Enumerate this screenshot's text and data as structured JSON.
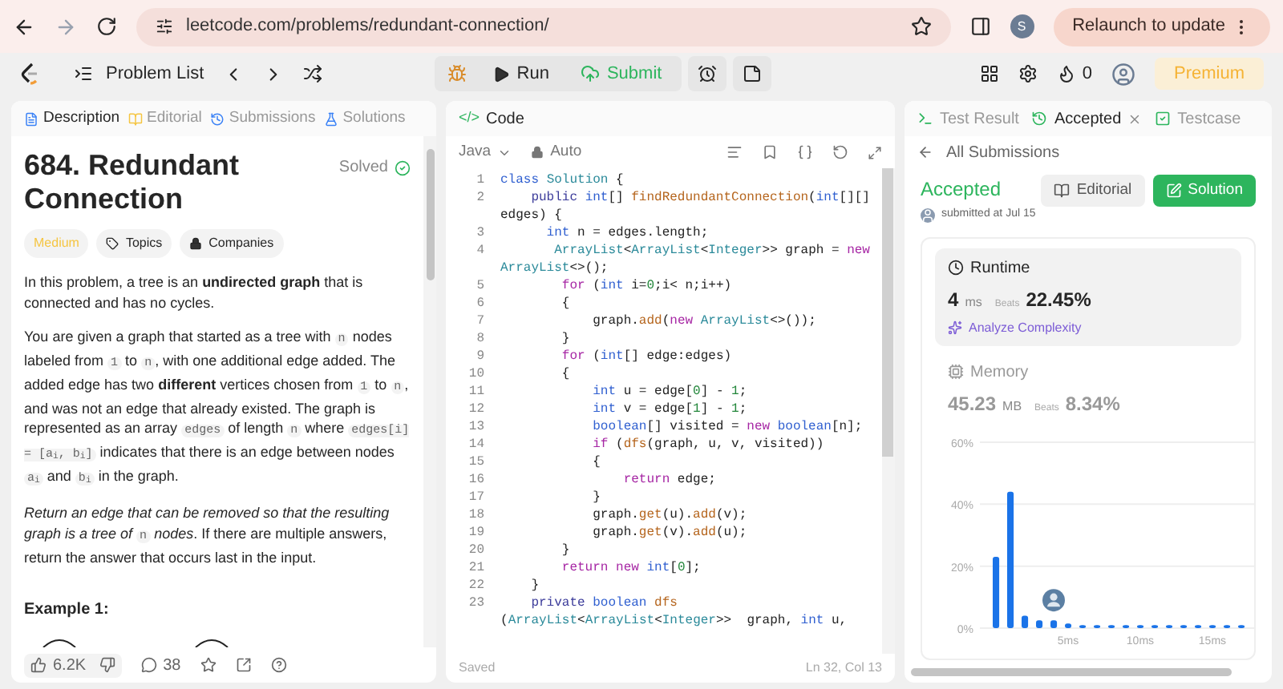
{
  "browser": {
    "url": "leetcode.com/problems/redundant-connection/",
    "profile_initial": "S",
    "relaunch": "Relaunch to update"
  },
  "nav": {
    "problem_list": "Problem List",
    "run": "Run",
    "submit": "Submit",
    "streak": "0",
    "premium": "Premium"
  },
  "description_panel": {
    "tabs": [
      {
        "label": "Description",
        "selected": true
      },
      {
        "label": "Editorial",
        "selected": false
      },
      {
        "label": "Submissions",
        "selected": false
      },
      {
        "label": "Solutions",
        "selected": false
      }
    ],
    "title": "684. Redundant Connection",
    "status": "Solved",
    "difficulty": "Medium",
    "tags": [
      {
        "label": "Topics",
        "kind": "tag"
      },
      {
        "label": "Companies",
        "kind": "lock"
      }
    ],
    "paragraphs": [
      [
        {
          "text": "In this problem, a tree is an ",
          "kind": "plain"
        },
        {
          "text": "undirected graph",
          "kind": "bold"
        },
        {
          "text": " that is connected and has no cycles.",
          "kind": "plain"
        }
      ],
      [
        {
          "text": "You are given a graph that started as a tree with ",
          "kind": "plain"
        },
        {
          "text": "n",
          "kind": "code"
        },
        {
          "text": " nodes labeled from ",
          "kind": "plain"
        },
        {
          "text": "1",
          "kind": "code"
        },
        {
          "text": " to ",
          "kind": "plain"
        },
        {
          "text": "n",
          "kind": "code"
        },
        {
          "text": ", with one additional edge added. The added edge has two ",
          "kind": "plain"
        },
        {
          "text": "different",
          "kind": "bold"
        },
        {
          "text": " vertices chosen from ",
          "kind": "plain"
        },
        {
          "text": "1",
          "kind": "code"
        },
        {
          "text": " to ",
          "kind": "plain"
        },
        {
          "text": "n",
          "kind": "code"
        },
        {
          "text": ", and was not an edge that already existed. The graph is represented as an array ",
          "kind": "plain"
        },
        {
          "text": "edges",
          "kind": "code"
        },
        {
          "text": " of length ",
          "kind": "plain"
        },
        {
          "text": "n",
          "kind": "code"
        },
        {
          "text": " where ",
          "kind": "plain"
        },
        {
          "text": "edges[i] = [a$_{i}$, b$_{i}$]",
          "kind": "code"
        },
        {
          "text": " indicates that there is an edge between nodes ",
          "kind": "plain"
        },
        {
          "text": "a$_{i}$",
          "kind": "code"
        },
        {
          "text": " and ",
          "kind": "plain"
        },
        {
          "text": "b$_{i}$",
          "kind": "code"
        },
        {
          "text": " in the graph.",
          "kind": "plain"
        }
      ],
      [
        {
          "text": "Return an edge that can be removed so that the resulting graph is a tree of ",
          "kind": "italic"
        },
        {
          "text": "n",
          "kind": "code"
        },
        {
          "text": " nodes",
          "kind": "italic"
        },
        {
          "text": ". If there are multiple answers, return the answer that occurs last in the input.",
          "kind": "plain"
        }
      ]
    ],
    "example": "Example 1:",
    "likes": "6.2K",
    "comments": "38"
  },
  "code_panel": {
    "title": "Code",
    "code_icon": "</>",
    "language": "Java",
    "mode": "Auto",
    "status": "Saved",
    "cursor": "Ln 32, Col 13",
    "lines": [
      {
        "number": "1",
        "tokens": [
          {
            "text": "class",
            "kind": "k1"
          },
          {
            "text": " Solution",
            "kind": "ty"
          },
          {
            "text": " {",
            "kind": "p"
          }
        ]
      },
      {
        "number": "2",
        "tokens": [
          {
            "text": "    public ",
            "kind": "k3"
          },
          {
            "text": "int",
            "kind": "k1"
          },
          {
            "text": "[] ",
            "kind": "p"
          },
          {
            "text": "findRedundantConnection",
            "kind": "fn"
          },
          {
            "text": "(",
            "kind": "p"
          },
          {
            "text": "int",
            "kind": "k1"
          },
          {
            "text": "[][]",
            "kind": "p"
          }
        ],
        "wrap": [
          {
            "text": "edges) {",
            "kind": "p"
          }
        ]
      },
      {
        "number": "3",
        "tokens": [
          {
            "text": "      int",
            "kind": "k1"
          },
          {
            "text": " n = edges.length;",
            "kind": "p"
          }
        ]
      },
      {
        "number": "4",
        "tokens": [
          {
            "text": "       ArrayList",
            "kind": "ty"
          },
          {
            "text": "<",
            "kind": "p"
          },
          {
            "text": "ArrayList",
            "kind": "ty"
          },
          {
            "text": "<",
            "kind": "p"
          },
          {
            "text": "Integer",
            "kind": "ty"
          },
          {
            "text": ">> graph = ",
            "kind": "p"
          },
          {
            "text": "new",
            "kind": "k2"
          }
        ],
        "wrap": [
          {
            "text": "ArrayList",
            "kind": "ty"
          },
          {
            "text": "<>();",
            "kind": "p"
          }
        ]
      },
      {
        "number": "5",
        "tokens": [
          {
            "text": "        for",
            "kind": "k2"
          },
          {
            "text": " (",
            "kind": "p"
          },
          {
            "text": "int",
            "kind": "k1"
          },
          {
            "text": " i=",
            "kind": "p"
          },
          {
            "text": "0",
            "kind": "num"
          },
          {
            "text": ";i< n;i++)",
            "kind": "p"
          }
        ]
      },
      {
        "number": "6",
        "tokens": [
          {
            "text": "        {",
            "kind": "p"
          }
        ]
      },
      {
        "number": "7",
        "tokens": [
          {
            "text": "            graph.",
            "kind": "p"
          },
          {
            "text": "add",
            "kind": "fn"
          },
          {
            "text": "(",
            "kind": "p"
          },
          {
            "text": "new ",
            "kind": "k2"
          },
          {
            "text": "ArrayList",
            "kind": "ty"
          },
          {
            "text": "<>());",
            "kind": "p"
          }
        ]
      },
      {
        "number": "8",
        "tokens": [
          {
            "text": "        }",
            "kind": "p"
          }
        ]
      },
      {
        "number": "9",
        "tokens": [
          {
            "text": "        for",
            "kind": "k2"
          },
          {
            "text": " (",
            "kind": "p"
          },
          {
            "text": "int",
            "kind": "k1"
          },
          {
            "text": "[] edge:edges)",
            "kind": "p"
          }
        ]
      },
      {
        "number": "10",
        "tokens": [
          {
            "text": "        {",
            "kind": "p"
          }
        ]
      },
      {
        "number": "11",
        "tokens": [
          {
            "text": "            int",
            "kind": "k1"
          },
          {
            "text": " u = edge[",
            "kind": "p"
          },
          {
            "text": "0",
            "kind": "num"
          },
          {
            "text": "] - ",
            "kind": "p"
          },
          {
            "text": "1",
            "kind": "num"
          },
          {
            "text": ";",
            "kind": "p"
          }
        ]
      },
      {
        "number": "12",
        "tokens": [
          {
            "text": "            int",
            "kind": "k1"
          },
          {
            "text": " v = edge[",
            "kind": "p"
          },
          {
            "text": "1",
            "kind": "num"
          },
          {
            "text": "] - ",
            "kind": "p"
          },
          {
            "text": "1",
            "kind": "num"
          },
          {
            "text": ";",
            "kind": "p"
          }
        ]
      },
      {
        "number": "13",
        "tokens": [
          {
            "text": "            boolean",
            "kind": "k1"
          },
          {
            "text": "[] visited = ",
            "kind": "p"
          },
          {
            "text": "new ",
            "kind": "k2"
          },
          {
            "text": "boolean",
            "kind": "k1"
          },
          {
            "text": "[n];",
            "kind": "p"
          }
        ]
      },
      {
        "number": "14",
        "tokens": [
          {
            "text": "            if",
            "kind": "k2"
          },
          {
            "text": " (",
            "kind": "p"
          },
          {
            "text": "dfs",
            "kind": "fn"
          },
          {
            "text": "(graph, u, v, visited))",
            "kind": "p"
          }
        ]
      },
      {
        "number": "15",
        "tokens": [
          {
            "text": "            {",
            "kind": "p"
          }
        ]
      },
      {
        "number": "16",
        "tokens": [
          {
            "text": "                return",
            "kind": "k2"
          },
          {
            "text": " edge;",
            "kind": "p"
          }
        ]
      },
      {
        "number": "17",
        "tokens": [
          {
            "text": "            }",
            "kind": "p"
          }
        ]
      },
      {
        "number": "18",
        "tokens": [
          {
            "text": "            graph.",
            "kind": "p"
          },
          {
            "text": "get",
            "kind": "fn"
          },
          {
            "text": "(u).",
            "kind": "p"
          },
          {
            "text": "add",
            "kind": "fn"
          },
          {
            "text": "(v);",
            "kind": "p"
          }
        ]
      },
      {
        "number": "19",
        "tokens": [
          {
            "text": "            graph.",
            "kind": "p"
          },
          {
            "text": "get",
            "kind": "fn"
          },
          {
            "text": "(v).",
            "kind": "p"
          },
          {
            "text": "add",
            "kind": "fn"
          },
          {
            "text": "(u);",
            "kind": "p"
          }
        ]
      },
      {
        "number": "20",
        "tokens": [
          {
            "text": "        }",
            "kind": "p"
          }
        ]
      },
      {
        "number": "21",
        "tokens": [
          {
            "text": "        return new ",
            "kind": "k2"
          },
          {
            "text": "int",
            "kind": "k1"
          },
          {
            "text": "[",
            "kind": "p"
          },
          {
            "text": "0",
            "kind": "num"
          },
          {
            "text": "];",
            "kind": "p"
          }
        ]
      },
      {
        "number": "22",
        "tokens": [
          {
            "text": "    }",
            "kind": "p"
          }
        ]
      },
      {
        "number": "23",
        "tokens": [
          {
            "text": "    private ",
            "kind": "k3"
          },
          {
            "text": "boolean ",
            "kind": "k1"
          },
          {
            "text": "dfs",
            "kind": "fn"
          }
        ],
        "wrap": [
          {
            "text": "(",
            "kind": "p"
          },
          {
            "text": "ArrayList",
            "kind": "ty"
          },
          {
            "text": "<",
            "kind": "p"
          },
          {
            "text": "ArrayList",
            "kind": "ty"
          },
          {
            "text": "<",
            "kind": "p"
          },
          {
            "text": "Integer",
            "kind": "ty"
          },
          {
            "text": ">>  graph, ",
            "kind": "p"
          },
          {
            "text": "int",
            "kind": "k1"
          },
          {
            "text": " u,",
            "kind": "p"
          }
        ]
      }
    ]
  },
  "result_panel": {
    "tabs": [
      {
        "label": "Test Result",
        "selected": false,
        "kind": "terminal"
      },
      {
        "label": "Accepted",
        "selected": true,
        "kind": "history"
      },
      {
        "label": "Testcase",
        "selected": false,
        "kind": "check"
      }
    ],
    "back": "All Submissions",
    "verdict": "Accepted",
    "submitted": "submitted at Jul 15",
    "editorial": "Editorial",
    "solution": "Solution",
    "metrics": [
      {
        "label": "Runtime",
        "value": "4",
        "unit": "ms",
        "beats_label": "Beats",
        "beats": "22.45%",
        "selected": true,
        "kind": "clock",
        "analyze": "Analyze Complexity"
      },
      {
        "label": "Memory",
        "value": "45.23",
        "unit": "MB",
        "beats_label": "Beats",
        "beats": "8.34%",
        "selected": false,
        "kind": "chip"
      }
    ],
    "chart_data": {
      "type": "bar",
      "categories": [
        null,
        null,
        null,
        null,
        null,
        "5ms",
        null,
        null,
        null,
        null,
        "10ms",
        null,
        null,
        null,
        null,
        "15ms",
        null,
        null
      ],
      "series": [
        {
          "color": "#1a73e8",
          "values": [
            23,
            44,
            4,
            2.5,
            2.5,
            1.5,
            1,
            1,
            1,
            1,
            1,
            1,
            1,
            1,
            1,
            1,
            1,
            1
          ]
        }
      ],
      "ylim": [
        0,
        60
      ],
      "yticks": [
        {
          "value": 0,
          "label": "0%"
        },
        {
          "value": 20,
          "label": "20%"
        },
        {
          "value": 40,
          "label": "40%"
        },
        {
          "value": 60,
          "label": "60%"
        }
      ]
    }
  }
}
